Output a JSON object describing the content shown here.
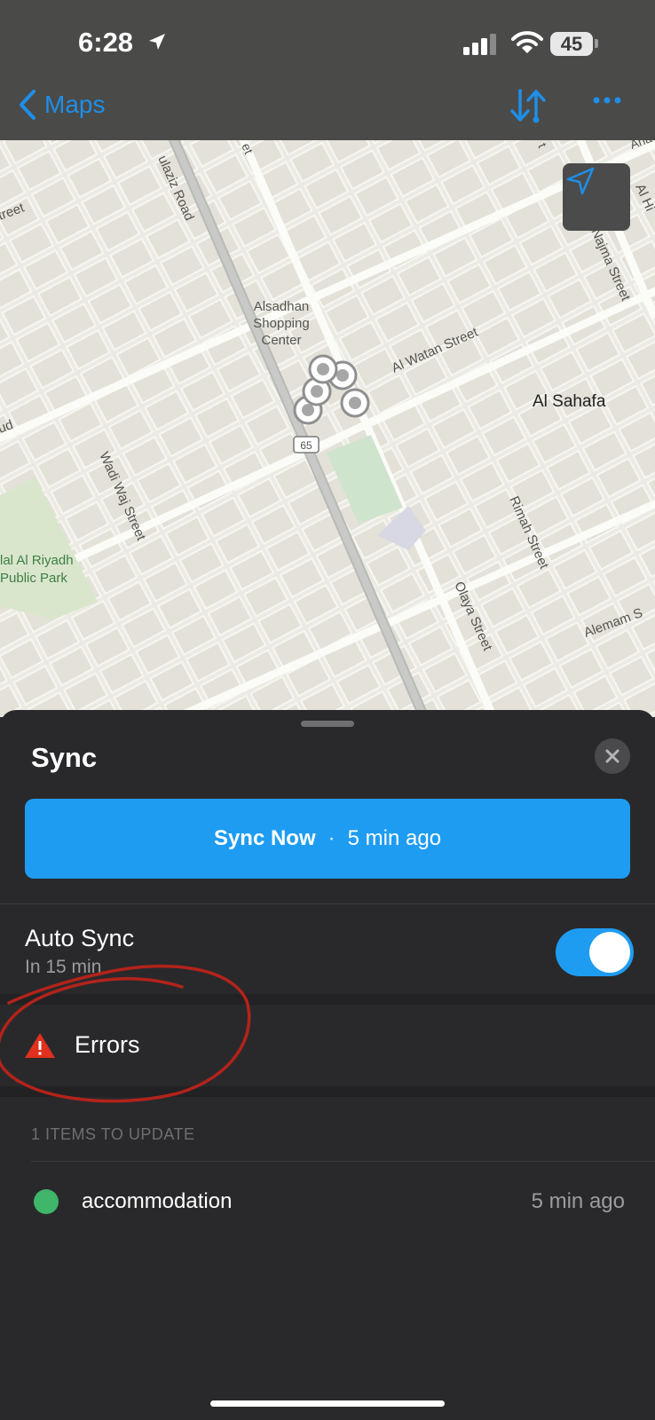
{
  "status_bar": {
    "time": "6:28",
    "battery": "45"
  },
  "nav": {
    "back_label": "Maps"
  },
  "map": {
    "labels": {
      "road_1": "ulaziz Road",
      "road_2": "treet",
      "road_3": "Al Watan Street",
      "road_4": "Najma Street",
      "road_5": "Wadi Waj Street",
      "road_6": "Rimah Street",
      "road_7": "Olaya Street",
      "road_8": "Alemam S",
      "road_9": "Al Hi",
      "road_10": "Ana",
      "poi_1_line1": "Alsadhan",
      "poi_1_line2": "Shopping",
      "poi_1_line3": "Center",
      "district": "Al Sahafa",
      "park_line1": "lal Al Riyadh",
      "park_line2": "Public Park",
      "highway_shield": "65",
      "fragment_1": "ud",
      "fragment_2": "et",
      "fragment_3": "t"
    }
  },
  "sheet": {
    "title": "Sync",
    "sync_button": {
      "label": "Sync Now",
      "separator": "·",
      "last_sync": "5 min ago"
    },
    "auto_sync": {
      "title": "Auto Sync",
      "subtitle": "In 15 min",
      "enabled": true
    },
    "errors": {
      "label": "Errors"
    },
    "section_header": "1 ITEMS TO UPDATE",
    "items": [
      {
        "name": "accommodation",
        "time": "5 min ago",
        "status_color": "#3fb66a"
      }
    ]
  },
  "colors": {
    "accent": "#1e9cf2",
    "warning": "#e0301e",
    "annotation": "#b3231a"
  }
}
